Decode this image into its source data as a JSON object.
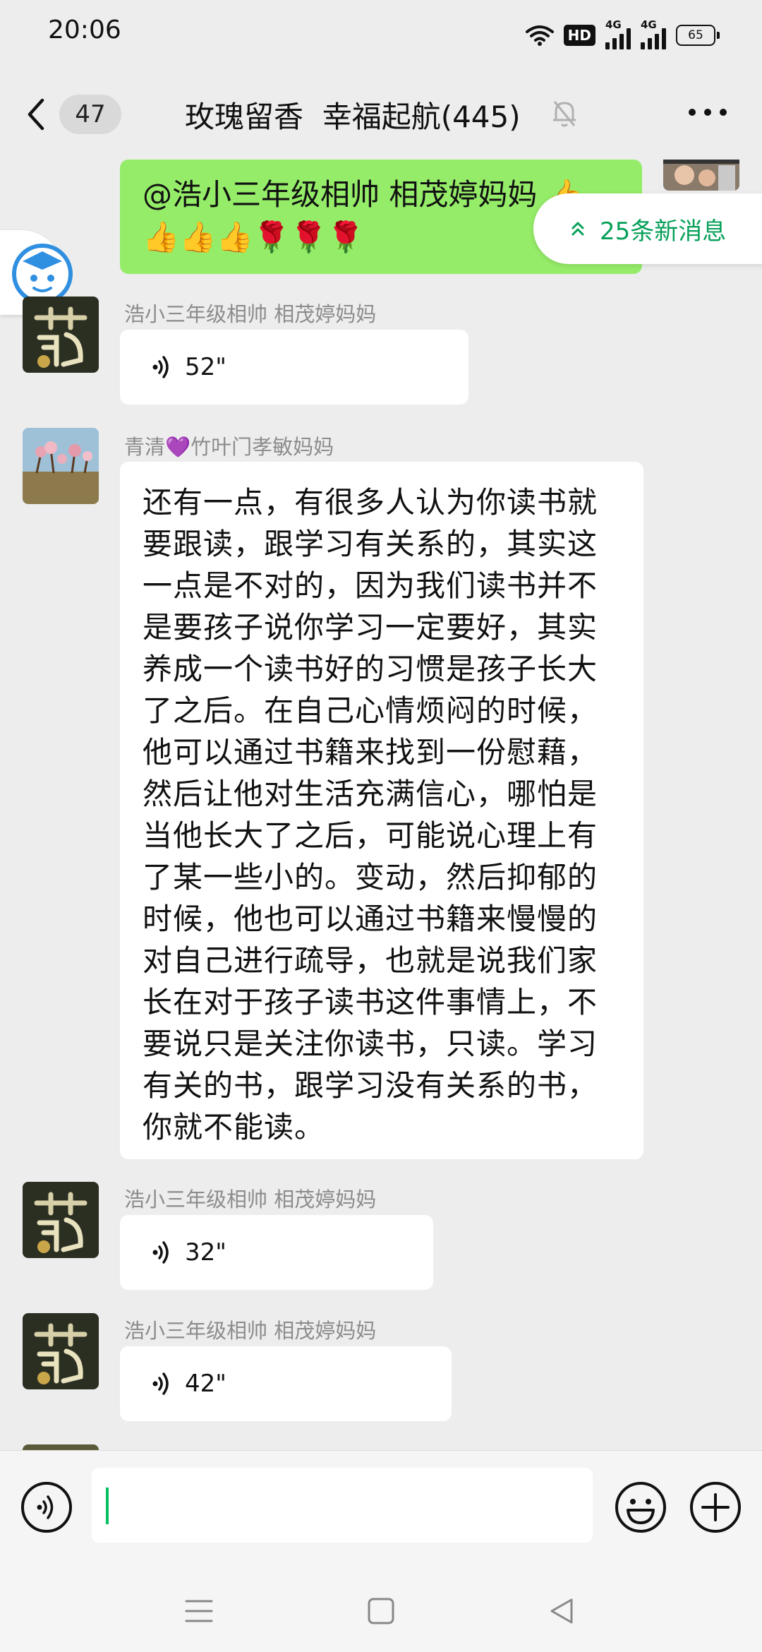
{
  "status_bar": {
    "time": "20:06",
    "hd_label": "HD",
    "network_1": "4G",
    "network_2": "4G",
    "battery": "65"
  },
  "header": {
    "back_count": "47",
    "title": "玫瑰留香  幸福起航(445)"
  },
  "new_messages": "25条新消息",
  "messages": [
    {
      "type": "text-self",
      "text": "@浩小三年级相帅 相茂婷妈妈 👍\n👍👍👍🌹🌹🌹"
    },
    {
      "type": "voice",
      "sender": "浩小三年级相帅  相茂婷妈妈",
      "duration": "52\""
    },
    {
      "type": "text",
      "sender": "青清💜竹叶门孝敏妈妈",
      "text": "还有一点，有很多人认为你读书就\n要跟读，跟学习有关系的，其实这\n一点是不对的，因为我们读书并不\n是要孩子说你学习一定要好，其实\n养成一个读书好的习惯是孩子长大\n了之后。在自己心情烦闷的时候，\n他可以通过书籍来找到一份慰藉，\n然后让他对生活充满信心，哪怕是\n当他长大了之后，可能说心理上有\n了某一些小的。变动，然后抑郁的\n时候，他也可以通过书籍来慢慢的\n对自己进行疏导，也就是说我们家\n长在对于孩子读书这件事情上，不\n要说只是关注你读书，只读。学习\n有关的书，跟学习没有关系的书，\n你就不能读。"
    },
    {
      "type": "voice",
      "sender": "浩小三年级相帅  相茂婷妈妈",
      "duration": "32\""
    },
    {
      "type": "voice",
      "sender": "浩小三年级相帅  相茂婷妈妈",
      "duration": "42\""
    }
  ],
  "icons": {
    "back": "chevron-left-icon",
    "mute": "bell-off-icon",
    "more": "more-icon",
    "voice_input": "voice-icon",
    "emoji": "emoji-icon",
    "add": "plus-icon"
  },
  "colors": {
    "accent": "#07c160",
    "self_bubble": "#95ec69",
    "background": "#ededed"
  }
}
